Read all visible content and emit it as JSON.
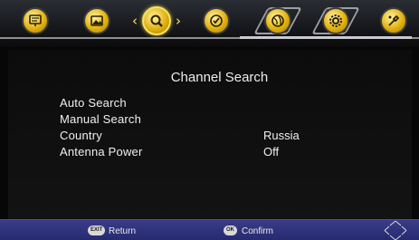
{
  "topbar": {
    "icons": [
      {
        "name": "tv-settings-icon"
      },
      {
        "name": "picture-icon"
      },
      {
        "name": "search-icon"
      },
      {
        "name": "clock-icon"
      },
      {
        "name": "globe-icon"
      },
      {
        "name": "gear-icon"
      },
      {
        "name": "tools-icon"
      }
    ],
    "active_icon": "search-icon",
    "accent_color": "#e2b10e"
  },
  "page": {
    "title": "Channel Search",
    "items": [
      {
        "label": "Auto Search",
        "value": ""
      },
      {
        "label": "Manual Search",
        "value": ""
      },
      {
        "label": "Country",
        "value": "Russia"
      },
      {
        "label": "Antenna Power",
        "value": "Off"
      }
    ]
  },
  "footer": {
    "return_key": "EXIT",
    "return_label": "Return",
    "confirm_key": "OK",
    "confirm_label": "Confirm",
    "bar_color": "#2e3278"
  }
}
